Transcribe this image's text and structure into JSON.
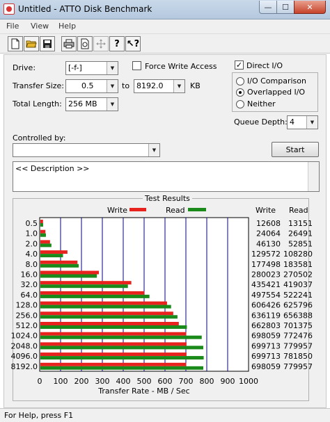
{
  "window": {
    "title": "Untitled - ATTO Disk Benchmark",
    "minimize": "—",
    "maximize": "☐",
    "close": "✕"
  },
  "menu": [
    "File",
    "View",
    "Help"
  ],
  "toolbar": [
    "new-icon",
    "open-icon",
    "save-icon",
    "print-icon",
    "print-preview-icon",
    "move-icon",
    "help-icon",
    "context-help-icon"
  ],
  "form": {
    "drive_label": "Drive:",
    "drive_value": "[-f-]",
    "force_write_label": "Force Write Access",
    "direct_io_label": "Direct I/O",
    "direct_io_checked": true,
    "transfer_size_label": "Transfer Size:",
    "transfer_from": "0.5",
    "to_label": "to",
    "transfer_to": "8192.0",
    "kb_label": "KB",
    "total_length_label": "Total Length:",
    "total_length_value": "256 MB",
    "io_comparison_label": "I/O Comparison",
    "overlapped_io_label": "Overlapped I/O",
    "neither_label": "Neither",
    "queue_depth_label": "Queue Depth:",
    "queue_depth_value": "4",
    "controlled_by_label": "Controlled by:",
    "controlled_by_value": "",
    "start_button": "Start",
    "description": "<< Description >>"
  },
  "results": {
    "title": "Test Results",
    "write_legend": "Write",
    "read_legend": "Read",
    "write_header": "Write",
    "read_header": "Read"
  },
  "colors": {
    "write": "#e8221c",
    "read": "#1a8a1a",
    "grid": "#000080"
  },
  "chart_data": {
    "type": "bar",
    "orientation": "horizontal",
    "title": "Test Results",
    "xlabel": "Transfer Rate - MB / Sec",
    "xlim": [
      0,
      1000
    ],
    "x_ticks": [
      "0",
      "100",
      "200",
      "300",
      "400",
      "500",
      "600",
      "700",
      "800",
      "900",
      "1000"
    ],
    "grid": true,
    "legend": "top",
    "categories": [
      "0.5",
      "1.0",
      "2.0",
      "4.0",
      "8.0",
      "16.0",
      "32.0",
      "64.0",
      "128.0",
      "256.0",
      "512.0",
      "1024.0",
      "2048.0",
      "4096.0",
      "8192.0"
    ],
    "series": [
      {
        "name": "Write",
        "values": [
          12608,
          24064,
          46130,
          129572,
          177498,
          280023,
          435421,
          497554,
          606426,
          636119,
          662803,
          698059,
          699713,
          699713,
          698059
        ]
      },
      {
        "name": "Read",
        "values": [
          13151,
          26491,
          52851,
          108280,
          183581,
          270502,
          419037,
          522241,
          625796,
          656388,
          701375,
          772476,
          779957,
          781850,
          779957
        ]
      }
    ]
  },
  "status": "For Help, press F1"
}
